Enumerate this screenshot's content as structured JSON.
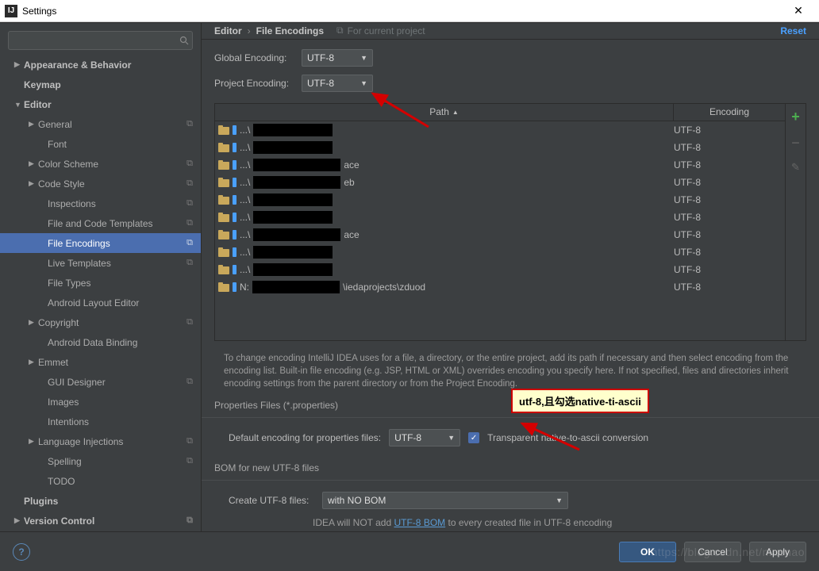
{
  "window": {
    "title": "Settings"
  },
  "sidebar": {
    "search_placeholder": "",
    "items": [
      {
        "label": "Appearance & Behavior",
        "bold": true,
        "arrow": "right",
        "lvl": 1
      },
      {
        "label": "Keymap",
        "bold": true,
        "arrow": "",
        "lvl": 1
      },
      {
        "label": "Editor",
        "bold": true,
        "arrow": "down",
        "lvl": 1
      },
      {
        "label": "General",
        "bold": false,
        "arrow": "right",
        "lvl": 2,
        "badge": true
      },
      {
        "label": "Font",
        "bold": false,
        "arrow": "",
        "lvl": 3
      },
      {
        "label": "Color Scheme",
        "bold": false,
        "arrow": "right",
        "lvl": 2,
        "badge": true
      },
      {
        "label": "Code Style",
        "bold": false,
        "arrow": "right",
        "lvl": 2,
        "badge": true
      },
      {
        "label": "Inspections",
        "bold": false,
        "arrow": "",
        "lvl": 3,
        "badge": true
      },
      {
        "label": "File and Code Templates",
        "bold": false,
        "arrow": "",
        "lvl": 3,
        "badge": true
      },
      {
        "label": "File Encodings",
        "bold": false,
        "arrow": "",
        "lvl": 3,
        "badge": true,
        "selected": true
      },
      {
        "label": "Live Templates",
        "bold": false,
        "arrow": "",
        "lvl": 3,
        "badge": true
      },
      {
        "label": "File Types",
        "bold": false,
        "arrow": "",
        "lvl": 3
      },
      {
        "label": "Android Layout Editor",
        "bold": false,
        "arrow": "",
        "lvl": 3
      },
      {
        "label": "Copyright",
        "bold": false,
        "arrow": "right",
        "lvl": 2,
        "badge": true
      },
      {
        "label": "Android Data Binding",
        "bold": false,
        "arrow": "",
        "lvl": 3
      },
      {
        "label": "Emmet",
        "bold": false,
        "arrow": "right",
        "lvl": 2
      },
      {
        "label": "GUI Designer",
        "bold": false,
        "arrow": "",
        "lvl": 3,
        "badge": true
      },
      {
        "label": "Images",
        "bold": false,
        "arrow": "",
        "lvl": 3
      },
      {
        "label": "Intentions",
        "bold": false,
        "arrow": "",
        "lvl": 3
      },
      {
        "label": "Language Injections",
        "bold": false,
        "arrow": "right",
        "lvl": 2,
        "badge": true
      },
      {
        "label": "Spelling",
        "bold": false,
        "arrow": "",
        "lvl": 3,
        "badge": true
      },
      {
        "label": "TODO",
        "bold": false,
        "arrow": "",
        "lvl": 3
      },
      {
        "label": "Plugins",
        "bold": true,
        "arrow": "",
        "lvl": 1
      },
      {
        "label": "Version Control",
        "bold": true,
        "arrow": "right",
        "lvl": 1,
        "badge": true
      }
    ]
  },
  "breadcrumbs": {
    "a": "Editor",
    "b": "File Encodings",
    "hint": "For current project",
    "reset": "Reset"
  },
  "form": {
    "global_label": "Global Encoding:",
    "global_value": "UTF-8",
    "project_label": "Project Encoding:",
    "project_value": "UTF-8"
  },
  "table": {
    "head_path": "Path",
    "head_enc": "Encoding",
    "rows": [
      {
        "prefix": "...\\",
        "redact": 100,
        "suffix": "",
        "enc": "UTF-8"
      },
      {
        "prefix": "...\\",
        "redact": 100,
        "suffix": "",
        "enc": "UTF-8"
      },
      {
        "prefix": "...\\",
        "redact": 110,
        "suffix": "ace",
        "enc": "UTF-8"
      },
      {
        "prefix": "...\\",
        "redact": 110,
        "suffix": "eb",
        "enc": "UTF-8"
      },
      {
        "prefix": "...\\",
        "redact": 100,
        "suffix": "",
        "enc": "UTF-8"
      },
      {
        "prefix": "...\\",
        "redact": 100,
        "suffix": "",
        "enc": "UTF-8"
      },
      {
        "prefix": "...\\",
        "redact": 110,
        "suffix": "ace",
        "enc": "UTF-8"
      },
      {
        "prefix": "...\\",
        "redact": 100,
        "suffix": "",
        "enc": "UTF-8"
      },
      {
        "prefix": "...\\",
        "redact": 100,
        "suffix": "",
        "enc": "UTF-8"
      },
      {
        "prefix": "N:",
        "redact": 110,
        "suffix": "\\iedaprojects\\zduod",
        "enc": "UTF-8"
      }
    ]
  },
  "help": {
    "text": "To change encoding IntelliJ IDEA uses for a file, a directory, or the entire project, add its path if necessary and then select encoding from the encoding list. Built-in file encoding (e.g. JSP, HTML or XML) overrides encoding you specify here. If not specified, files and directories inherit encoding settings from the parent directory or from the Project Encoding."
  },
  "props": {
    "section": "Properties Files (*.properties)",
    "default_label": "Default encoding for properties files:",
    "default_value": "UTF-8",
    "checkbox_label": "Transparent native-to-ascii conversion"
  },
  "bom": {
    "section": "BOM for new UTF-8 files",
    "create_label": "Create UTF-8 files:",
    "create_value": "with NO BOM",
    "note_prefix": "IDEA will NOT add ",
    "note_link": "UTF-8 BOM",
    "note_suffix": " to every created file in UTF-8 encoding"
  },
  "footer": {
    "ok": "OK",
    "cancel": "Cancel",
    "apply": "Apply"
  },
  "annotation": {
    "box": "utf-8,且勾选native-ti-ascii"
  },
  "watermark": "https://blog.csdn.net/niaonao"
}
